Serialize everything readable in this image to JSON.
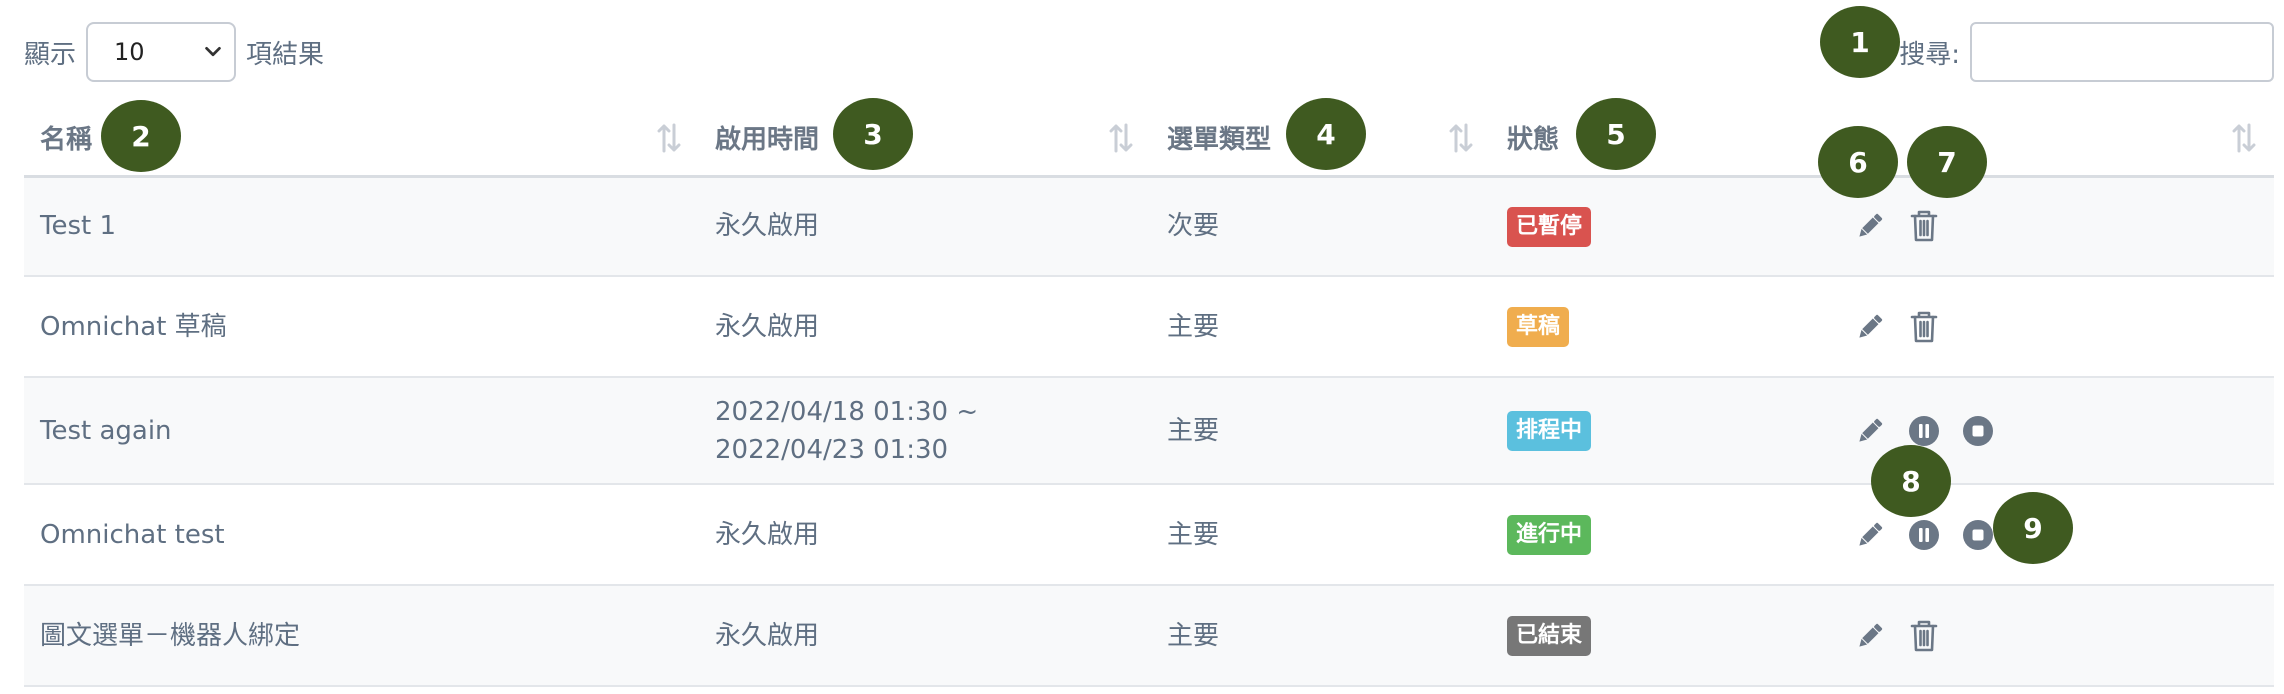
{
  "length_menu": {
    "prefix": "顯示",
    "value": "10",
    "suffix": "項結果"
  },
  "search": {
    "label": "搜尋:",
    "value": ""
  },
  "columns": [
    {
      "label": "名稱"
    },
    {
      "label": "啟用時間"
    },
    {
      "label": "選單類型"
    },
    {
      "label": "狀態"
    },
    {
      "label": ""
    }
  ],
  "rows": [
    {
      "name": "Test 1",
      "time": "永久啟用",
      "type": "次要",
      "status": {
        "label": "已暫停",
        "color": "#d9534f"
      },
      "actions": [
        "pencil-icon",
        "trash-icon"
      ]
    },
    {
      "name": "Omnichat 草稿",
      "time": "永久啟用",
      "type": "主要",
      "status": {
        "label": "草稿",
        "color": "#f0ad4e"
      },
      "actions": [
        "pencil-icon",
        "trash-icon"
      ]
    },
    {
      "name": "Test again",
      "time": "2022/04/18 01:30 ~ 2022/04/23 01:30",
      "type": "主要",
      "status": {
        "label": "排程中",
        "color": "#5bc0de"
      },
      "actions": [
        "pencil-icon",
        "pause-icon",
        "stop-icon"
      ]
    },
    {
      "name": "Omnichat test",
      "time": "永久啟用",
      "type": "主要",
      "status": {
        "label": "進行中",
        "color": "#5cb85c"
      },
      "actions": [
        "pencil-icon",
        "pause-icon",
        "stop-icon"
      ]
    },
    {
      "name": "圖文選單－機器人綁定",
      "time": "永久啟用",
      "type": "主要",
      "status": {
        "label": "已結束",
        "color": "#777777"
      },
      "actions": [
        "pencil-icon",
        "trash-icon"
      ]
    }
  ],
  "markers": [
    "1",
    "2",
    "3",
    "4",
    "5",
    "6",
    "7",
    "8",
    "9"
  ],
  "colors": {
    "marker": "#3f5a20",
    "text": "#5f6f82",
    "icon": "#6b7786"
  }
}
